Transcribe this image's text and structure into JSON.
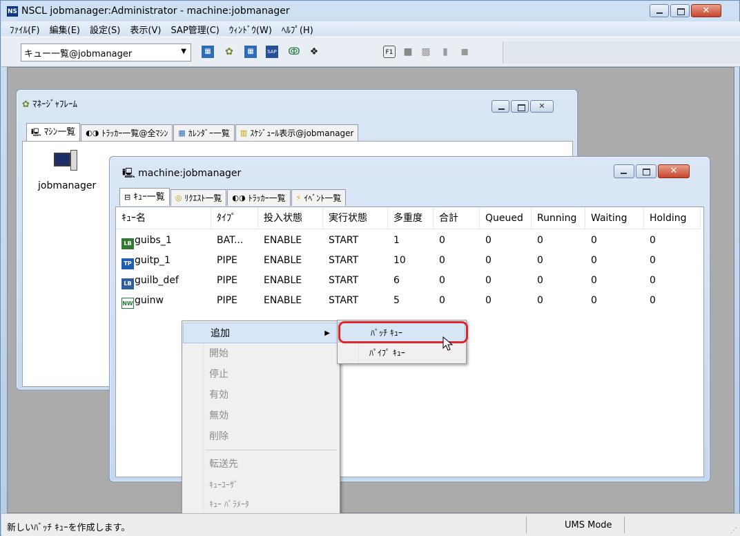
{
  "window": {
    "title": "NSCL jobmanager:Administrator - machine:jobmanager",
    "icon_text": "NS"
  },
  "menu": [
    "ﾌｧｲﾙ(F)",
    "編集(E)",
    "設定(S)",
    "表示(V)",
    "SAP管理(C)",
    "ｳｨﾝﾄﾞｳ(W)",
    "ﾍﾙﾌﾟ(H)"
  ],
  "toolbar": {
    "combo_value": "キュー一覧@jobmanager",
    "icons": [
      "queue-list-icon",
      "manager-frame-icon",
      "calendar-icon",
      "sap-icon",
      "network-icon",
      "binoculars-icon",
      "f1-help-icon",
      "folder-icon",
      "machine-icon",
      "document-icon",
      "tracker-icon"
    ]
  },
  "manager_frame": {
    "title": "ﾏﾈｰｼﾞｬﾌﾚｰﾑ",
    "tabs": [
      "ﾏｼﾝ一覧",
      "ﾄﾗｯｶｰ一覧@全ﾏｼﾝ",
      "ｶﾚﾝﾀﾞｰ一覧",
      "ｽｹｼﾞｭｰﾙ表示@jobmanager"
    ],
    "machine_label": "jobmanager"
  },
  "machine_window": {
    "title": "machine:jobmanager",
    "tabs": [
      "ｷｭｰ一覧",
      "ﾘｸｴｽﾄ一覧",
      "ﾄﾗｯｶｰ一覧",
      "ｲﾍﾞﾝﾄ一覧"
    ],
    "columns": [
      "ｷｭｰ名",
      "ﾀｲﾌﾟ",
      "投入状態",
      "実行状態",
      "多重度",
      "合計",
      "Queued",
      "Running",
      "Waiting",
      "Holding"
    ],
    "rows": [
      {
        "icon": "LB",
        "name": "guibs_1",
        "cells": [
          "BAT...",
          "ENABLE",
          "START",
          "1",
          "0",
          "0",
          "0",
          "0",
          "0"
        ]
      },
      {
        "icon": "TP",
        "name": "guitp_1",
        "cells": [
          "PIPE",
          "ENABLE",
          "START",
          "10",
          "0",
          "0",
          "0",
          "0",
          "0"
        ]
      },
      {
        "icon": "LB",
        "name": "guilb_def",
        "cells": [
          "PIPE",
          "ENABLE",
          "START",
          "6",
          "0",
          "0",
          "0",
          "0",
          "0"
        ]
      },
      {
        "icon": "NW",
        "name": "guinw",
        "cells": [
          "PIPE",
          "ENABLE",
          "START",
          "5",
          "0",
          "0",
          "0",
          "0",
          "0"
        ]
      }
    ]
  },
  "context_menu": {
    "items": [
      "追加",
      "開始",
      "停止",
      "有効",
      "無効",
      "削除",
      "転送先",
      "ｷｭｰﾕｰｻﾞ",
      "ｷｭｰ ﾊﾟﾗﾒｰﾀ"
    ],
    "submenu": [
      "ﾊﾞｯﾁ ｷｭｰ",
      "ﾊﾟｲﾌﾟ ｷｭｰ"
    ]
  },
  "status": {
    "message": "新しいﾊﾞｯﾁ ｷｭｰを作成します。",
    "mode": "UMS Mode"
  },
  "colors": {
    "highlight_ring": "#e0242a",
    "menu_highlight": "#d7e6f7",
    "workspace": "#ababab"
  }
}
